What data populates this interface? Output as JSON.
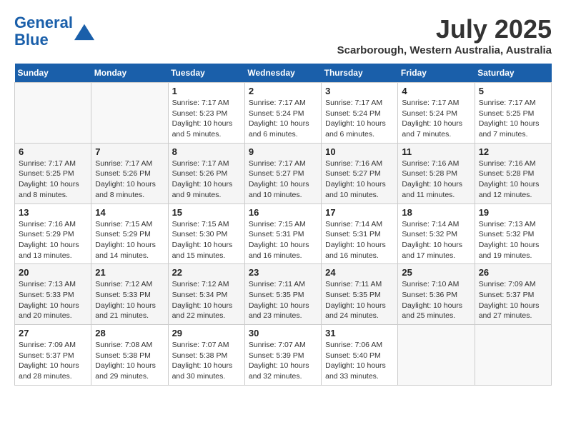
{
  "header": {
    "logo_line1": "General",
    "logo_line2": "Blue",
    "month": "July 2025",
    "location": "Scarborough, Western Australia, Australia"
  },
  "weekdays": [
    "Sunday",
    "Monday",
    "Tuesday",
    "Wednesday",
    "Thursday",
    "Friday",
    "Saturday"
  ],
  "weeks": [
    [
      {
        "day": "",
        "info": ""
      },
      {
        "day": "",
        "info": ""
      },
      {
        "day": "1",
        "info": "Sunrise: 7:17 AM\nSunset: 5:23 PM\nDaylight: 10 hours\nand 5 minutes."
      },
      {
        "day": "2",
        "info": "Sunrise: 7:17 AM\nSunset: 5:24 PM\nDaylight: 10 hours\nand 6 minutes."
      },
      {
        "day": "3",
        "info": "Sunrise: 7:17 AM\nSunset: 5:24 PM\nDaylight: 10 hours\nand 6 minutes."
      },
      {
        "day": "4",
        "info": "Sunrise: 7:17 AM\nSunset: 5:24 PM\nDaylight: 10 hours\nand 7 minutes."
      },
      {
        "day": "5",
        "info": "Sunrise: 7:17 AM\nSunset: 5:25 PM\nDaylight: 10 hours\nand 7 minutes."
      }
    ],
    [
      {
        "day": "6",
        "info": "Sunrise: 7:17 AM\nSunset: 5:25 PM\nDaylight: 10 hours\nand 8 minutes."
      },
      {
        "day": "7",
        "info": "Sunrise: 7:17 AM\nSunset: 5:26 PM\nDaylight: 10 hours\nand 8 minutes."
      },
      {
        "day": "8",
        "info": "Sunrise: 7:17 AM\nSunset: 5:26 PM\nDaylight: 10 hours\nand 9 minutes."
      },
      {
        "day": "9",
        "info": "Sunrise: 7:17 AM\nSunset: 5:27 PM\nDaylight: 10 hours\nand 10 minutes."
      },
      {
        "day": "10",
        "info": "Sunrise: 7:16 AM\nSunset: 5:27 PM\nDaylight: 10 hours\nand 10 minutes."
      },
      {
        "day": "11",
        "info": "Sunrise: 7:16 AM\nSunset: 5:28 PM\nDaylight: 10 hours\nand 11 minutes."
      },
      {
        "day": "12",
        "info": "Sunrise: 7:16 AM\nSunset: 5:28 PM\nDaylight: 10 hours\nand 12 minutes."
      }
    ],
    [
      {
        "day": "13",
        "info": "Sunrise: 7:16 AM\nSunset: 5:29 PM\nDaylight: 10 hours\nand 13 minutes."
      },
      {
        "day": "14",
        "info": "Sunrise: 7:15 AM\nSunset: 5:29 PM\nDaylight: 10 hours\nand 14 minutes."
      },
      {
        "day": "15",
        "info": "Sunrise: 7:15 AM\nSunset: 5:30 PM\nDaylight: 10 hours\nand 15 minutes."
      },
      {
        "day": "16",
        "info": "Sunrise: 7:15 AM\nSunset: 5:31 PM\nDaylight: 10 hours\nand 16 minutes."
      },
      {
        "day": "17",
        "info": "Sunrise: 7:14 AM\nSunset: 5:31 PM\nDaylight: 10 hours\nand 16 minutes."
      },
      {
        "day": "18",
        "info": "Sunrise: 7:14 AM\nSunset: 5:32 PM\nDaylight: 10 hours\nand 17 minutes."
      },
      {
        "day": "19",
        "info": "Sunrise: 7:13 AM\nSunset: 5:32 PM\nDaylight: 10 hours\nand 19 minutes."
      }
    ],
    [
      {
        "day": "20",
        "info": "Sunrise: 7:13 AM\nSunset: 5:33 PM\nDaylight: 10 hours\nand 20 minutes."
      },
      {
        "day": "21",
        "info": "Sunrise: 7:12 AM\nSunset: 5:33 PM\nDaylight: 10 hours\nand 21 minutes."
      },
      {
        "day": "22",
        "info": "Sunrise: 7:12 AM\nSunset: 5:34 PM\nDaylight: 10 hours\nand 22 minutes."
      },
      {
        "day": "23",
        "info": "Sunrise: 7:11 AM\nSunset: 5:35 PM\nDaylight: 10 hours\nand 23 minutes."
      },
      {
        "day": "24",
        "info": "Sunrise: 7:11 AM\nSunset: 5:35 PM\nDaylight: 10 hours\nand 24 minutes."
      },
      {
        "day": "25",
        "info": "Sunrise: 7:10 AM\nSunset: 5:36 PM\nDaylight: 10 hours\nand 25 minutes."
      },
      {
        "day": "26",
        "info": "Sunrise: 7:09 AM\nSunset: 5:37 PM\nDaylight: 10 hours\nand 27 minutes."
      }
    ],
    [
      {
        "day": "27",
        "info": "Sunrise: 7:09 AM\nSunset: 5:37 PM\nDaylight: 10 hours\nand 28 minutes."
      },
      {
        "day": "28",
        "info": "Sunrise: 7:08 AM\nSunset: 5:38 PM\nDaylight: 10 hours\nand 29 minutes."
      },
      {
        "day": "29",
        "info": "Sunrise: 7:07 AM\nSunset: 5:38 PM\nDaylight: 10 hours\nand 30 minutes."
      },
      {
        "day": "30",
        "info": "Sunrise: 7:07 AM\nSunset: 5:39 PM\nDaylight: 10 hours\nand 32 minutes."
      },
      {
        "day": "31",
        "info": "Sunrise: 7:06 AM\nSunset: 5:40 PM\nDaylight: 10 hours\nand 33 minutes."
      },
      {
        "day": "",
        "info": ""
      },
      {
        "day": "",
        "info": ""
      }
    ]
  ]
}
